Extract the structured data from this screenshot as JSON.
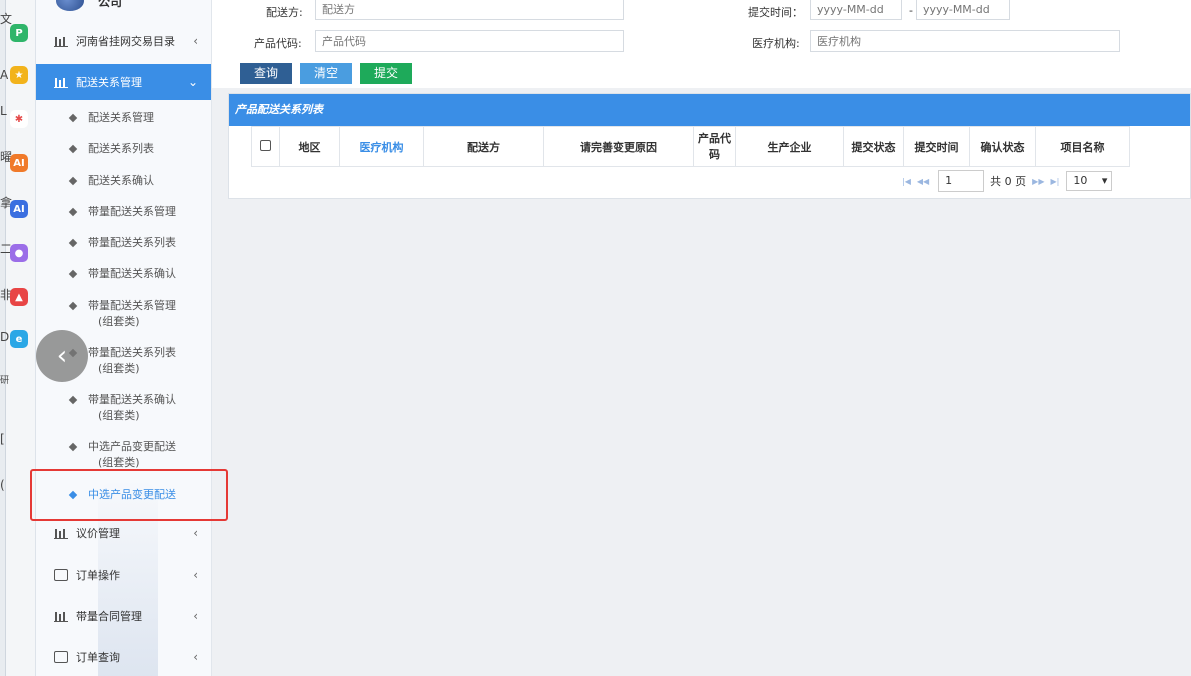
{
  "dock": {
    "chars": [
      "文",
      "A",
      "L",
      "曜",
      "拿",
      "二",
      "非",
      "D",
      "研",
      "[",
      "("
    ],
    "colors": [
      "#2fb56a",
      "#f2b31c",
      "#e54b4b",
      "#f07a2a",
      "#3b6fe0",
      "#9b6ee8",
      "#e84545",
      "#2aa7e6"
    ]
  },
  "sidebar": {
    "company": "公司",
    "items": [
      {
        "label": "河南省挂网交易目录",
        "icon": "grid"
      },
      {
        "label": "配送关系管理",
        "icon": "grid",
        "active": true
      },
      {
        "label": "议价管理",
        "icon": "grid"
      },
      {
        "label": "订单操作",
        "icon": "doc"
      },
      {
        "label": "带量合同管理",
        "icon": "grid"
      },
      {
        "label": "订单查询",
        "icon": "doc"
      }
    ],
    "subitems": [
      {
        "line1": "配送关系管理"
      },
      {
        "line1": "配送关系列表"
      },
      {
        "line1": "配送关系确认"
      },
      {
        "line1": "带量配送关系管理"
      },
      {
        "line1": "带量配送关系列表"
      },
      {
        "line1": "带量配送关系确认"
      },
      {
        "line1": "带量配送关系管理",
        "line2": "(组套类)"
      },
      {
        "line1": "带量配送关系列表",
        "line2": "(组套类)"
      },
      {
        "line1": "带量配送关系确认",
        "line2": "(组套类)"
      },
      {
        "line1": "中选产品变更配送",
        "line2": "(组套类)"
      },
      {
        "line1": "中选产品变更配送",
        "selected": true
      }
    ]
  },
  "form": {
    "distributor_label": "配送方:",
    "distributor_placeholder": "配送方",
    "product_code_label": "产品代码:",
    "product_code_placeholder": "产品代码",
    "submit_time_label": "提交时间：",
    "date_placeholder": "yyyy-MM-dd",
    "date_sep": "-",
    "hospital_label": "医疗机构:",
    "hospital_placeholder": "医疗机构",
    "query_btn": "查询",
    "clear_btn": "清空",
    "submit_btn": "提交"
  },
  "table": {
    "title": "产品配送关系列表",
    "columns": [
      {
        "label": "地区"
      },
      {
        "label": "医疗机构",
        "blue": true
      },
      {
        "label": "配送方"
      },
      {
        "label": "请完善变更原因"
      },
      {
        "label": "产品代码"
      },
      {
        "label": "生产企业"
      },
      {
        "label": "提交状态"
      },
      {
        "label": "提交时间"
      },
      {
        "label": "确认状态"
      },
      {
        "label": "项目名称"
      }
    ],
    "pager": {
      "page": "1",
      "total": "共 0 页",
      "page_size": "10"
    }
  },
  "colors": {
    "accent": "#3a8ee6",
    "query_btn": "#2f5f94",
    "clear_btn": "#4a9de0",
    "submit_btn": "#1eaa5a",
    "highlight": "#e53935"
  }
}
